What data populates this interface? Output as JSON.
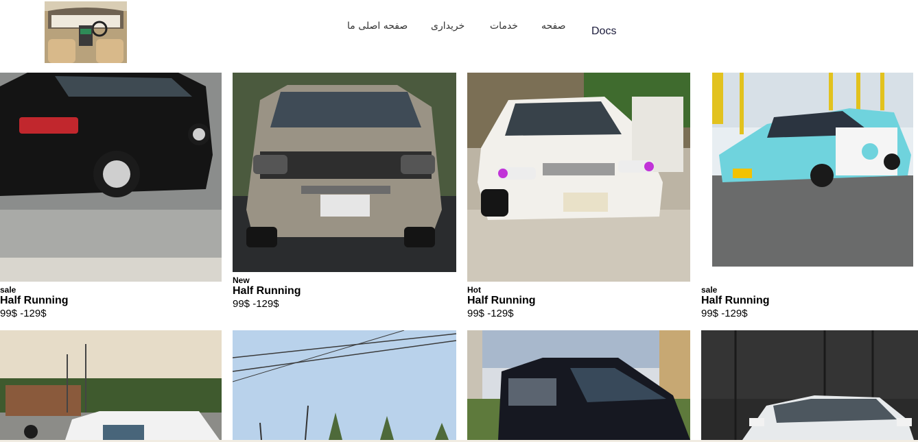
{
  "header": {
    "nav": [
      {
        "label": "صفحه اصلی ما"
      },
      {
        "label": "خریداری"
      },
      {
        "label": "خدمات"
      },
      {
        "label": "صفحه"
      },
      {
        "label": "Docs"
      }
    ]
  },
  "products": [
    {
      "tag": "sale",
      "title": "Half Running",
      "price": "99$ -129$",
      "image": "black-sedan-photo"
    },
    {
      "tag": "New",
      "title": "Half Running",
      "price": "99$ -129$",
      "image": "4runner-suv-photo"
    },
    {
      "tag": "Hot",
      "title": "Half Running",
      "price": "99$ -129$",
      "image": "white-corolla-photo"
    },
    {
      "tag": "sale",
      "title": "Half Running",
      "price": "99$ -129$",
      "image": "taxi-corolla-photo"
    }
  ],
  "second_row": [
    {
      "image": "street-truck-photo"
    },
    {
      "image": "sky-trees-photo"
    },
    {
      "image": "dark-van-photo"
    },
    {
      "image": "silver-car-photo"
    }
  ]
}
